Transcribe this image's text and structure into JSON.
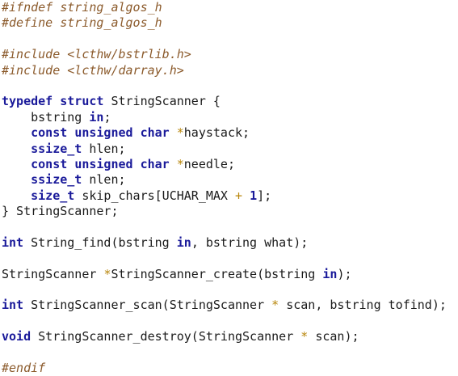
{
  "colors": {
    "background": "#ffffff",
    "preprocessor": "#8b5a2b",
    "keyword": "#1a1a9a",
    "operator": "#b8860b",
    "text": "#1a1a1a"
  },
  "code_lines": [
    [
      {
        "t": "#ifndef string_algos_h",
        "k": "comment"
      }
    ],
    [
      {
        "t": "#define string_algos_h",
        "k": "comment"
      }
    ],
    [],
    [
      {
        "t": "#include <lcthw/bstrlib.h>",
        "k": "comment"
      }
    ],
    [
      {
        "t": "#include <lcthw/darray.h>",
        "k": "comment"
      }
    ],
    [],
    [
      {
        "t": "typedef",
        "k": "keyword"
      },
      {
        "t": " ",
        "k": "plain"
      },
      {
        "t": "struct",
        "k": "keyword"
      },
      {
        "t": " StringScanner {",
        "k": "plain"
      }
    ],
    [
      {
        "t": "    bstring ",
        "k": "plain"
      },
      {
        "t": "in",
        "k": "keyword"
      },
      {
        "t": ";",
        "k": "plain"
      }
    ],
    [
      {
        "t": "    ",
        "k": "plain"
      },
      {
        "t": "const",
        "k": "keyword"
      },
      {
        "t": " ",
        "k": "plain"
      },
      {
        "t": "unsigned",
        "k": "keyword"
      },
      {
        "t": " ",
        "k": "plain"
      },
      {
        "t": "char",
        "k": "keyword"
      },
      {
        "t": " ",
        "k": "plain"
      },
      {
        "t": "*",
        "k": "operator"
      },
      {
        "t": "haystack;",
        "k": "plain"
      }
    ],
    [
      {
        "t": "    ",
        "k": "plain"
      },
      {
        "t": "ssize_t",
        "k": "type"
      },
      {
        "t": " hlen;",
        "k": "plain"
      }
    ],
    [
      {
        "t": "    ",
        "k": "plain"
      },
      {
        "t": "const",
        "k": "keyword"
      },
      {
        "t": " ",
        "k": "plain"
      },
      {
        "t": "unsigned",
        "k": "keyword"
      },
      {
        "t": " ",
        "k": "plain"
      },
      {
        "t": "char",
        "k": "keyword"
      },
      {
        "t": " ",
        "k": "plain"
      },
      {
        "t": "*",
        "k": "operator"
      },
      {
        "t": "needle;",
        "k": "plain"
      }
    ],
    [
      {
        "t": "    ",
        "k": "plain"
      },
      {
        "t": "ssize_t",
        "k": "type"
      },
      {
        "t": " nlen;",
        "k": "plain"
      }
    ],
    [
      {
        "t": "    ",
        "k": "plain"
      },
      {
        "t": "size_t",
        "k": "type"
      },
      {
        "t": " skip_chars[UCHAR_MAX ",
        "k": "plain"
      },
      {
        "t": "+",
        "k": "operator"
      },
      {
        "t": " ",
        "k": "plain"
      },
      {
        "t": "1",
        "k": "number"
      },
      {
        "t": "];",
        "k": "plain"
      }
    ],
    [
      {
        "t": "} StringScanner;",
        "k": "plain"
      }
    ],
    [],
    [
      {
        "t": "int",
        "k": "keyword"
      },
      {
        "t": " String_find(bstring ",
        "k": "plain"
      },
      {
        "t": "in",
        "k": "keyword"
      },
      {
        "t": ", bstring what);",
        "k": "plain"
      }
    ],
    [],
    [
      {
        "t": "StringScanner ",
        "k": "plain"
      },
      {
        "t": "*",
        "k": "operator"
      },
      {
        "t": "StringScanner_create(bstring ",
        "k": "plain"
      },
      {
        "t": "in",
        "k": "keyword"
      },
      {
        "t": ");",
        "k": "plain"
      }
    ],
    [],
    [
      {
        "t": "int",
        "k": "keyword"
      },
      {
        "t": " StringScanner_scan(StringScanner ",
        "k": "plain"
      },
      {
        "t": "*",
        "k": "operator"
      },
      {
        "t": " scan, bstring tofind);",
        "k": "plain"
      }
    ],
    [],
    [
      {
        "t": "void",
        "k": "keyword"
      },
      {
        "t": " StringScanner_destroy(StringScanner ",
        "k": "plain"
      },
      {
        "t": "*",
        "k": "operator"
      },
      {
        "t": " scan);",
        "k": "plain"
      }
    ],
    [],
    [
      {
        "t": "#endif",
        "k": "comment"
      }
    ]
  ]
}
